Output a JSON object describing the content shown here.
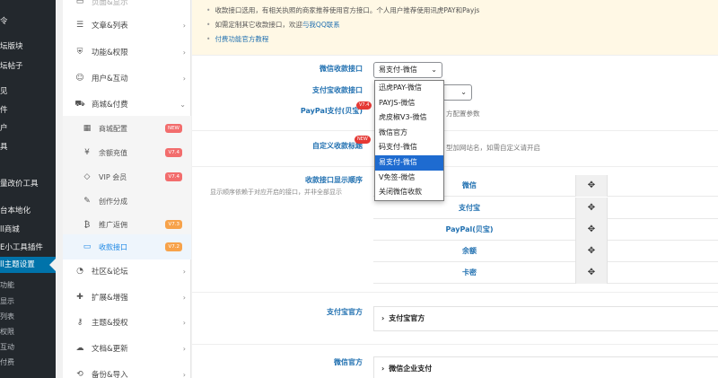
{
  "wp_sidebar": {
    "items": [
      {
        "label": "令"
      },
      {
        "label": "坛版块"
      },
      {
        "label": "坛帖子"
      },
      {
        "label": "见"
      },
      {
        "label": "件"
      },
      {
        "label": "户"
      },
      {
        "label": "具"
      },
      {
        "label": "量改价工具"
      },
      {
        "label": "台本地化"
      },
      {
        "label": "ll商城"
      },
      {
        "label": "E小工具插件"
      },
      {
        "label": "ll主题设置"
      },
      {
        "label": "功能"
      },
      {
        "label": "显示"
      },
      {
        "label": "列表"
      },
      {
        "label": "权限"
      },
      {
        "label": "互动"
      },
      {
        "label": "付费"
      }
    ]
  },
  "nav": {
    "items": [
      {
        "icon": "list-icon",
        "label": "文章&列表",
        "caret": "›"
      },
      {
        "icon": "shield-icon",
        "label": "功能&权限",
        "caret": "›"
      },
      {
        "icon": "user-icon",
        "label": "用户&互动",
        "caret": "›"
      },
      {
        "icon": "cart-icon",
        "label": "商城&付费",
        "caret": "⌄"
      }
    ],
    "sub_items": [
      {
        "icon": "store-icon",
        "label": "商城配置",
        "badge": "NEW"
      },
      {
        "icon": "yen-icon",
        "label": "余额充值",
        "badge": "V7.4"
      },
      {
        "icon": "diamond-icon",
        "label": "VIP 会员",
        "badge": "V7.4"
      },
      {
        "icon": "share-icon",
        "label": "创作分成",
        "badge": ""
      },
      {
        "icon": "bitcoin-icon",
        "label": "推广返佣",
        "badge": "V7.3"
      },
      {
        "icon": "card-icon",
        "label": "收款接口",
        "badge": "V7.2"
      }
    ],
    "items_bottom": [
      {
        "icon": "forum-icon",
        "label": "社区&论坛",
        "caret": "›"
      },
      {
        "icon": "puzzle-icon",
        "label": "扩展&增强",
        "caret": "›"
      },
      {
        "icon": "key-icon",
        "label": "主题&授权",
        "caret": "›"
      },
      {
        "icon": "cloud-icon",
        "label": "文档&更新",
        "caret": "›"
      },
      {
        "icon": "backup-icon",
        "label": "备份&导入",
        "caret": "›"
      }
    ]
  },
  "notice": {
    "lines": [
      "收款接口选用，有相关执照的商家推荐使用官方接口。个人用户推荐使用讯虎PAY和Payjs",
      "如需定制其它收款接口，欢迎",
      "付费功能官方教程"
    ],
    "link_contact": "与我QQ联系"
  },
  "fields": {
    "wechat_label": "微信收款接口",
    "wechat_value": "易支付-微信",
    "alipay_label": "支付宝收款接口",
    "paypal_label": "PayPal支付(贝宝)",
    "paypal_tag": "V7.4",
    "paypal_hint_tail": "方配置参数",
    "custom_label": "自定义收款标题",
    "custom_tag": "NEW",
    "custom_hint_tail": "型加网站名，如需自定义请开启",
    "order_label": "收款接口显示顺序",
    "order_hint": "显示顺序依赖于对应开启的接口，并非全部显示"
  },
  "dropdown": {
    "options": [
      "迅虎PAY-微信",
      "PAYJS-微信",
      "虎皮椒V3-微信",
      "微信官方",
      "码支付-微信",
      "易支付-微信",
      "V免签-微信",
      "关闭微信收款"
    ],
    "selected": "易支付-微信"
  },
  "order_rows": [
    "微信",
    "支付宝",
    "PayPal(贝宝)",
    "余额",
    "卡密"
  ],
  "alipay_official": {
    "label": "支付宝官方",
    "section": "支付宝官方"
  },
  "wechat_official": {
    "label": "微信官方",
    "section": "微信企业支付"
  },
  "colors": {
    "accent": "#2271b1",
    "wp_active": "#0073aa",
    "highlight": "#1e6bd0"
  }
}
